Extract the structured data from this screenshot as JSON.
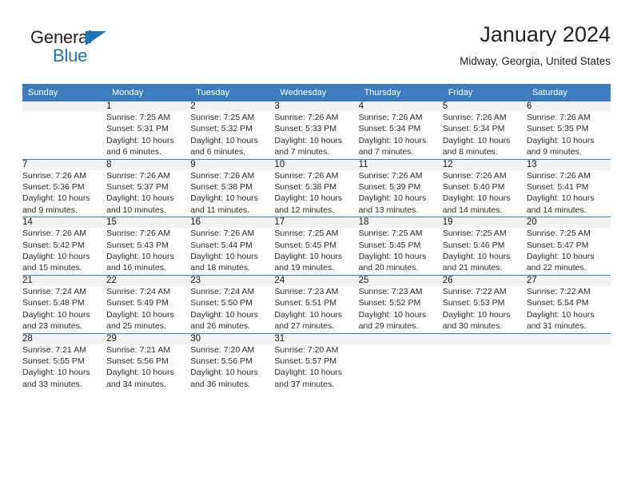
{
  "brand": {
    "name_part1": "General",
    "name_part2": "Blue",
    "triangle_icon": "triangle-icon",
    "accent_color": "#1b75bb"
  },
  "header": {
    "title": "January 2024",
    "subtitle": "Midway, Georgia, United States"
  },
  "theme": {
    "header_bg": "#3b7dc0",
    "daynum_bg": "#f2f2f2",
    "text": "#2a2a2a"
  },
  "calendar": {
    "weekday_headers": [
      "Sunday",
      "Monday",
      "Tuesday",
      "Wednesday",
      "Thursday",
      "Friday",
      "Saturday"
    ],
    "weeks": [
      [
        {
          "day": "",
          "lines": [
            "",
            "",
            "",
            ""
          ]
        },
        {
          "day": "1",
          "lines": [
            "Sunrise: 7:25 AM",
            "Sunset: 5:31 PM",
            "Daylight: 10 hours",
            "and 6 minutes."
          ]
        },
        {
          "day": "2",
          "lines": [
            "Sunrise: 7:25 AM",
            "Sunset: 5:32 PM",
            "Daylight: 10 hours",
            "and 6 minutes."
          ]
        },
        {
          "day": "3",
          "lines": [
            "Sunrise: 7:26 AM",
            "Sunset: 5:33 PM",
            "Daylight: 10 hours",
            "and 7 minutes."
          ]
        },
        {
          "day": "4",
          "lines": [
            "Sunrise: 7:26 AM",
            "Sunset: 5:34 PM",
            "Daylight: 10 hours",
            "and 7 minutes."
          ]
        },
        {
          "day": "5",
          "lines": [
            "Sunrise: 7:26 AM",
            "Sunset: 5:34 PM",
            "Daylight: 10 hours",
            "and 8 minutes."
          ]
        },
        {
          "day": "6",
          "lines": [
            "Sunrise: 7:26 AM",
            "Sunset: 5:35 PM",
            "Daylight: 10 hours",
            "and 9 minutes."
          ]
        }
      ],
      [
        {
          "day": "7",
          "lines": [
            "Sunrise: 7:26 AM",
            "Sunset: 5:36 PM",
            "Daylight: 10 hours",
            "and 9 minutes."
          ]
        },
        {
          "day": "8",
          "lines": [
            "Sunrise: 7:26 AM",
            "Sunset: 5:37 PM",
            "Daylight: 10 hours",
            "and 10 minutes."
          ]
        },
        {
          "day": "9",
          "lines": [
            "Sunrise: 7:26 AM",
            "Sunset: 5:38 PM",
            "Daylight: 10 hours",
            "and 11 minutes."
          ]
        },
        {
          "day": "10",
          "lines": [
            "Sunrise: 7:26 AM",
            "Sunset: 5:38 PM",
            "Daylight: 10 hours",
            "and 12 minutes."
          ]
        },
        {
          "day": "11",
          "lines": [
            "Sunrise: 7:26 AM",
            "Sunset: 5:39 PM",
            "Daylight: 10 hours",
            "and 13 minutes."
          ]
        },
        {
          "day": "12",
          "lines": [
            "Sunrise: 7:26 AM",
            "Sunset: 5:40 PM",
            "Daylight: 10 hours",
            "and 14 minutes."
          ]
        },
        {
          "day": "13",
          "lines": [
            "Sunrise: 7:26 AM",
            "Sunset: 5:41 PM",
            "Daylight: 10 hours",
            "and 14 minutes."
          ]
        }
      ],
      [
        {
          "day": "14",
          "lines": [
            "Sunrise: 7:26 AM",
            "Sunset: 5:42 PM",
            "Daylight: 10 hours",
            "and 15 minutes."
          ]
        },
        {
          "day": "15",
          "lines": [
            "Sunrise: 7:26 AM",
            "Sunset: 5:43 PM",
            "Daylight: 10 hours",
            "and 16 minutes."
          ]
        },
        {
          "day": "16",
          "lines": [
            "Sunrise: 7:26 AM",
            "Sunset: 5:44 PM",
            "Daylight: 10 hours",
            "and 18 minutes."
          ]
        },
        {
          "day": "17",
          "lines": [
            "Sunrise: 7:25 AM",
            "Sunset: 5:45 PM",
            "Daylight: 10 hours",
            "and 19 minutes."
          ]
        },
        {
          "day": "18",
          "lines": [
            "Sunrise: 7:25 AM",
            "Sunset: 5:45 PM",
            "Daylight: 10 hours",
            "and 20 minutes."
          ]
        },
        {
          "day": "19",
          "lines": [
            "Sunrise: 7:25 AM",
            "Sunset: 5:46 PM",
            "Daylight: 10 hours",
            "and 21 minutes."
          ]
        },
        {
          "day": "20",
          "lines": [
            "Sunrise: 7:25 AM",
            "Sunset: 5:47 PM",
            "Daylight: 10 hours",
            "and 22 minutes."
          ]
        }
      ],
      [
        {
          "day": "21",
          "lines": [
            "Sunrise: 7:24 AM",
            "Sunset: 5:48 PM",
            "Daylight: 10 hours",
            "and 23 minutes."
          ]
        },
        {
          "day": "22",
          "lines": [
            "Sunrise: 7:24 AM",
            "Sunset: 5:49 PM",
            "Daylight: 10 hours",
            "and 25 minutes."
          ]
        },
        {
          "day": "23",
          "lines": [
            "Sunrise: 7:24 AM",
            "Sunset: 5:50 PM",
            "Daylight: 10 hours",
            "and 26 minutes."
          ]
        },
        {
          "day": "24",
          "lines": [
            "Sunrise: 7:23 AM",
            "Sunset: 5:51 PM",
            "Daylight: 10 hours",
            "and 27 minutes."
          ]
        },
        {
          "day": "25",
          "lines": [
            "Sunrise: 7:23 AM",
            "Sunset: 5:52 PM",
            "Daylight: 10 hours",
            "and 29 minutes."
          ]
        },
        {
          "day": "26",
          "lines": [
            "Sunrise: 7:22 AM",
            "Sunset: 5:53 PM",
            "Daylight: 10 hours",
            "and 30 minutes."
          ]
        },
        {
          "day": "27",
          "lines": [
            "Sunrise: 7:22 AM",
            "Sunset: 5:54 PM",
            "Daylight: 10 hours",
            "and 31 minutes."
          ]
        }
      ],
      [
        {
          "day": "28",
          "lines": [
            "Sunrise: 7:21 AM",
            "Sunset: 5:55 PM",
            "Daylight: 10 hours",
            "and 33 minutes."
          ]
        },
        {
          "day": "29",
          "lines": [
            "Sunrise: 7:21 AM",
            "Sunset: 5:56 PM",
            "Daylight: 10 hours",
            "and 34 minutes."
          ]
        },
        {
          "day": "30",
          "lines": [
            "Sunrise: 7:20 AM",
            "Sunset: 5:56 PM",
            "Daylight: 10 hours",
            "and 36 minutes."
          ]
        },
        {
          "day": "31",
          "lines": [
            "Sunrise: 7:20 AM",
            "Sunset: 5:57 PM",
            "Daylight: 10 hours",
            "and 37 minutes."
          ]
        },
        {
          "day": "",
          "lines": [
            "",
            "",
            "",
            ""
          ]
        },
        {
          "day": "",
          "lines": [
            "",
            "",
            "",
            ""
          ]
        },
        {
          "day": "",
          "lines": [
            "",
            "",
            "",
            ""
          ]
        }
      ]
    ]
  }
}
